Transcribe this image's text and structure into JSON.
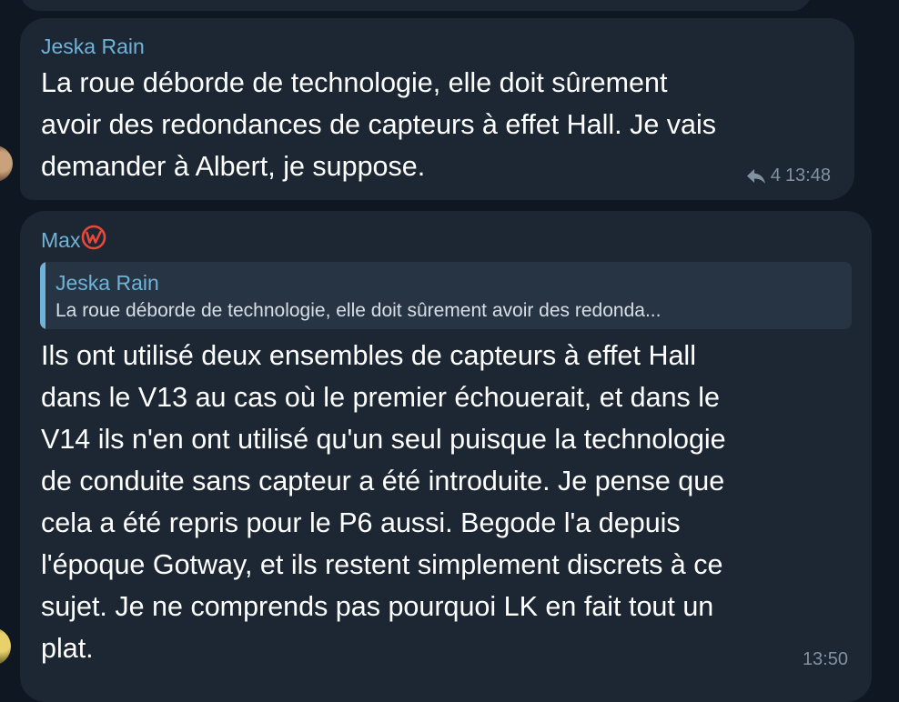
{
  "messages": [
    {
      "sender": "Jeska Rain",
      "text": "La roue déborde de technologie, elle doit sûrement\navoir des redondances de capteurs à effet Hall. Je vais\ndemander à Albert, je suppose.",
      "reply_count": "4",
      "time": "13:48"
    },
    {
      "sender": "Max",
      "sender_badge_icon": "w-brand-badge-icon",
      "reply_to": {
        "sender": "Jeska Rain",
        "text": "La roue déborde de technologie, elle doit sûrement avoir des redonda..."
      },
      "text": "Ils ont utilisé deux ensembles de capteurs à effet Hall\ndans le V13 au cas où le premier échouerait, et dans le\nV14 ils n'en ont utilisé qu'un seul puisque la technologie\nde conduite sans capteur a été introduite. Je pense que\ncela a été repris pour le P6 aussi. Begode l'a depuis\nl'époque Gotway, et ils restent simplement discrets à ce\nsujet. Je ne comprends pas pourquoi LK en fait tout un\nplat.",
      "time": "13:50"
    }
  ],
  "colors": {
    "background": "#0f1822",
    "bubble": "#1d2733",
    "sender_name": "#6fb3d8",
    "quote_background": "#273444",
    "meta_text": "#8092a2",
    "badge": "#e8473a"
  }
}
